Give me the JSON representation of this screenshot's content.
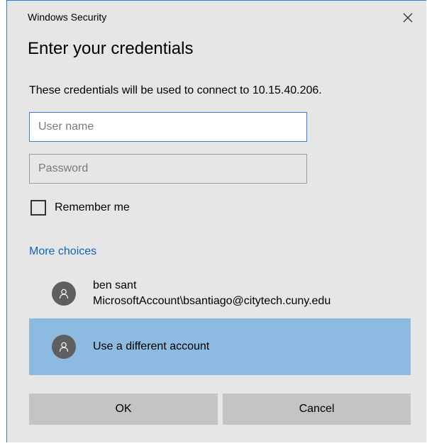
{
  "window": {
    "title": "Windows Security",
    "close_icon": "close-icon"
  },
  "dialog": {
    "heading": "Enter your credentials",
    "description": "These credentials will be used to connect to 10.15.40.206."
  },
  "form": {
    "username_placeholder": "User name",
    "username_value": "",
    "password_placeholder": "Password",
    "password_value": "",
    "remember_label": "Remember me",
    "remember_checked": false
  },
  "more_choices": {
    "label": "More choices",
    "accounts": [
      {
        "name": "ben sant",
        "detail": "MicrosoftAccount\\bsantiago@citytech.cuny.edu",
        "icon": "user-icon",
        "selected": false
      },
      {
        "name": "Use a different account",
        "icon": "user-icon",
        "selected": true
      }
    ]
  },
  "buttons": {
    "ok_label": "OK",
    "cancel_label": "Cancel"
  },
  "colors": {
    "link": "#0f64b8",
    "selected_row": "#8dbae0",
    "focus_border": "#3d7ec9"
  }
}
